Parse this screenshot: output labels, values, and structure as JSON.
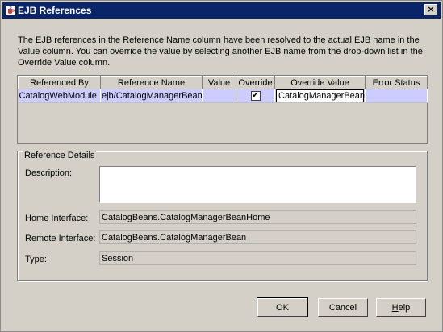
{
  "window": {
    "title": "EJB References",
    "close_glyph": "×",
    "icon": "java-cup-icon"
  },
  "description": "The EJB references in the Reference Name column have been resolved to the actual EJB name in the Value column.  You can override the value by selecting another EJB name from the drop-down list in the Override Value column.",
  "table": {
    "columns": [
      "Referenced By",
      "Reference Name",
      "Value",
      "Override",
      "Override Value",
      "Error Status"
    ],
    "rows": [
      {
        "referenced_by": "CatalogWebModule",
        "reference_name": "ejb/CatalogManagerBean",
        "value": "",
        "override_checked": true,
        "override_mark": "✔",
        "override_value": "CatalogManagerBean",
        "error_status": ""
      }
    ]
  },
  "details": {
    "legend": "Reference Details",
    "description_label": "Description:",
    "description_value": "",
    "home_label": "Home Interface:",
    "home_value": "CatalogBeans.CatalogManagerBeanHome",
    "remote_label": "Remote Interface:",
    "remote_value": "CatalogBeans.CatalogManagerBean",
    "type_label": "Type:",
    "type_value": "Session"
  },
  "buttons": {
    "ok": "OK",
    "cancel": "Cancel",
    "help_first": "H",
    "help_rest": "elp"
  },
  "colors": {
    "titlebar": "#0a246a",
    "selected_row": "#ccccff",
    "dialog_bg": "#d4d0c8"
  }
}
